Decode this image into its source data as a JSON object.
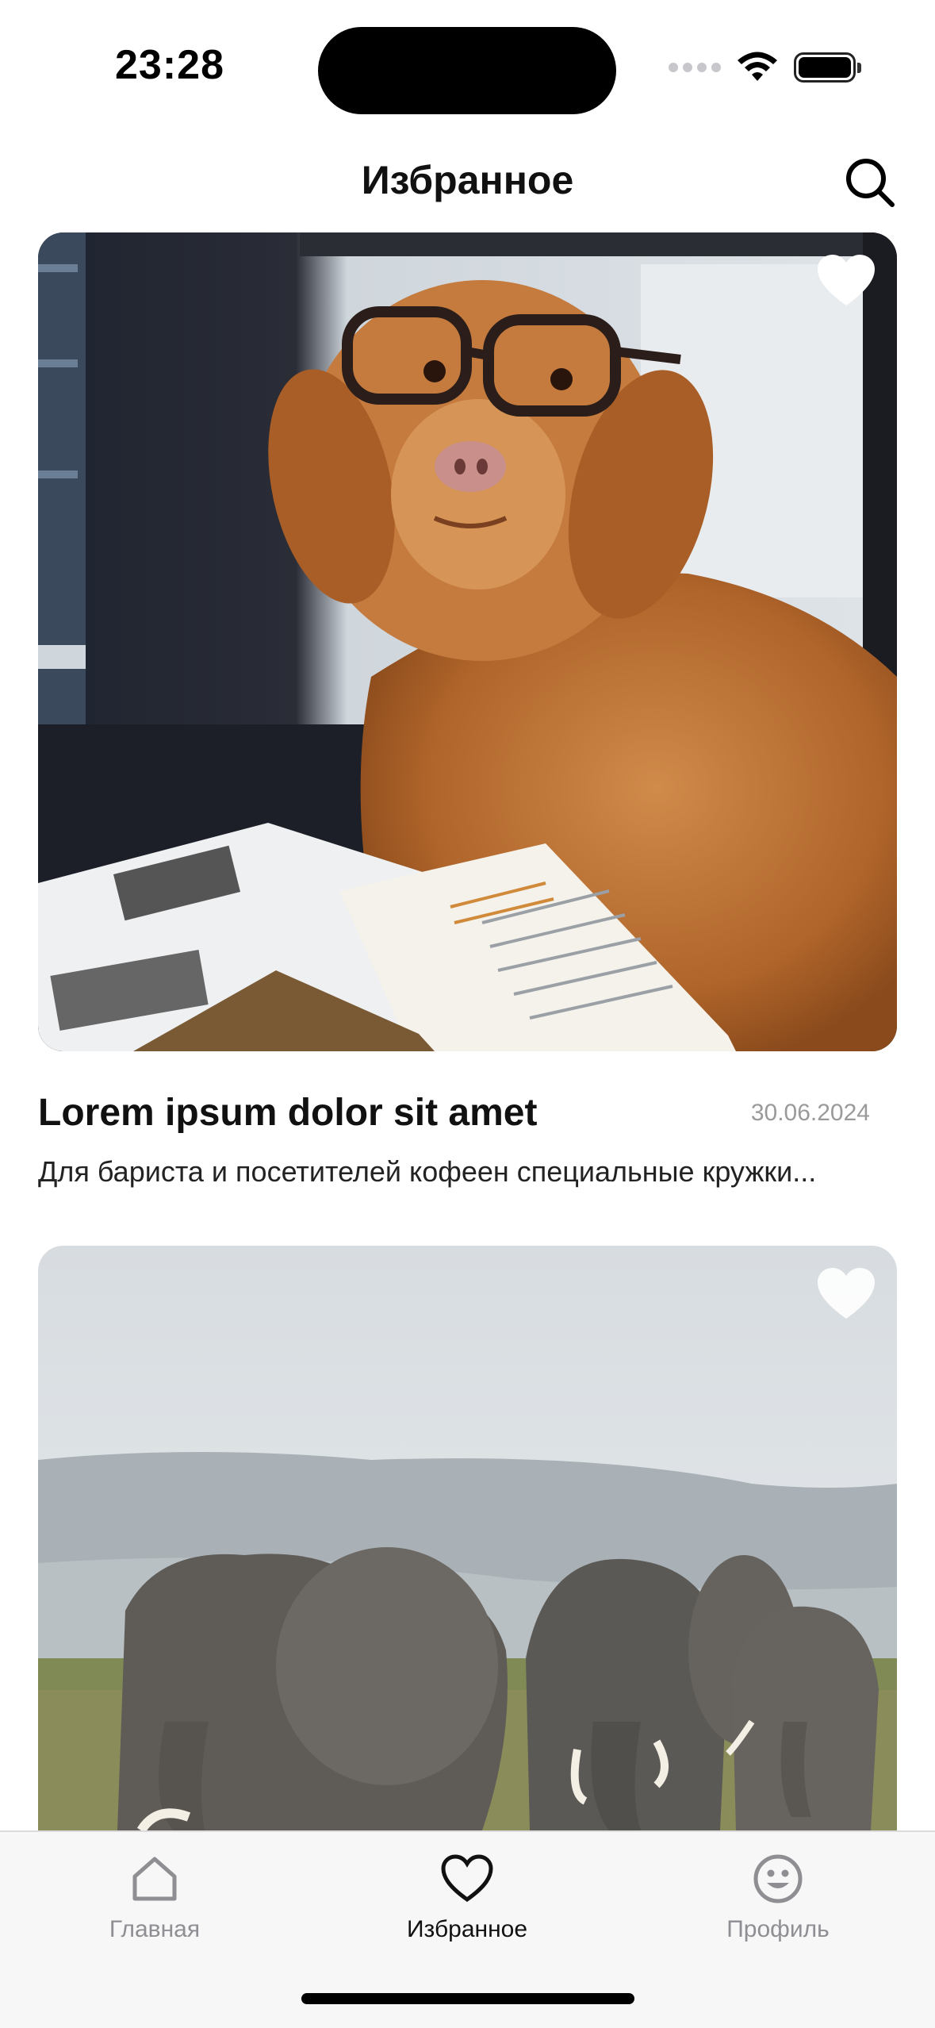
{
  "status_bar": {
    "time": "23:28"
  },
  "header": {
    "title": "Избранное",
    "search_icon": "search-icon"
  },
  "feed": {
    "items": [
      {
        "image": "dog-with-glasses-photo",
        "favorite_icon": "heart-filled-icon",
        "title": "Lorem ipsum dolor sit amet",
        "date": "30.06.2024",
        "description": "Для бариста и посетителей кофеен специальные кружки..."
      },
      {
        "image": "elephants-photo",
        "favorite_icon": "heart-filled-icon"
      }
    ]
  },
  "tab_bar": {
    "tabs": [
      {
        "label": "Главная",
        "icon": "home-icon",
        "active": false
      },
      {
        "label": "Избранное",
        "icon": "heart-outline-icon",
        "active": true
      },
      {
        "label": "Профиль",
        "icon": "smiley-icon",
        "active": false
      }
    ]
  },
  "colors": {
    "background": "#ffffff",
    "tab_bar_background": "#f7f7f7",
    "inactive_tab": "#8e8e93",
    "active_tab": "#111111",
    "date_text": "#9a9a9a"
  }
}
